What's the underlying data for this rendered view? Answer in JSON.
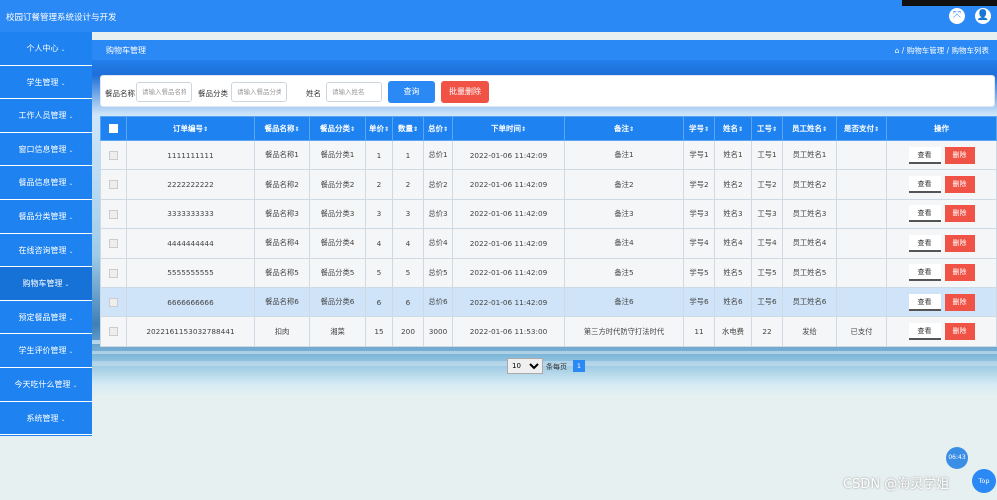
{
  "app": {
    "title": "校园订餐管理系统设计与开发"
  },
  "sidebar": {
    "items": [
      {
        "label": "个人中心"
      },
      {
        "label": "学生管理"
      },
      {
        "label": "工作人员管理"
      },
      {
        "label": "窗口信息管理"
      },
      {
        "label": "餐品信息管理"
      },
      {
        "label": "餐品分类管理"
      },
      {
        "label": "在线咨询管理"
      },
      {
        "label": "购物车管理"
      },
      {
        "label": "预定餐品管理"
      },
      {
        "label": "学生评价管理"
      },
      {
        "label": "今天吃什么管理"
      },
      {
        "label": "系统管理"
      }
    ]
  },
  "header": {
    "page_title": "购物车管理",
    "breadcrumb": "⌂ / 购物车管理 / 购物车列表"
  },
  "search": {
    "name_label": "餐品名称",
    "name_placeholder": "请输入餐品名称",
    "cat_label": "餐品分类",
    "cat_placeholder": "请输入餐品分类",
    "student_label": "姓名",
    "student_placeholder": "请输入姓名",
    "query_label": "查询",
    "batch_delete_label": "批量删除"
  },
  "table": {
    "headers": [
      "订单编号",
      "餐品名称",
      "餐品分类",
      "单价",
      "数量",
      "总价",
      "下单时间",
      "备注",
      "学号",
      "姓名",
      "工号",
      "员工姓名",
      "是否支付",
      "操作"
    ],
    "rows": [
      [
        "1111111111",
        "餐品名称1",
        "餐品分类1",
        "1",
        "1",
        "总价1",
        "2022-01-06 11:42:09",
        "备注1",
        "学号1",
        "姓名1",
        "工号1",
        "员工姓名1",
        ""
      ],
      [
        "2222222222",
        "餐品名称2",
        "餐品分类2",
        "2",
        "2",
        "总价2",
        "2022-01-06 11:42:09",
        "备注2",
        "学号2",
        "姓名2",
        "工号2",
        "员工姓名2",
        ""
      ],
      [
        "3333333333",
        "餐品名称3",
        "餐品分类3",
        "3",
        "3",
        "总价3",
        "2022-01-06 11:42:09",
        "备注3",
        "学号3",
        "姓名3",
        "工号3",
        "员工姓名3",
        ""
      ],
      [
        "4444444444",
        "餐品名称4",
        "餐品分类4",
        "4",
        "4",
        "总价4",
        "2022-01-06 11:42:09",
        "备注4",
        "学号4",
        "姓名4",
        "工号4",
        "员工姓名4",
        ""
      ],
      [
        "5555555555",
        "餐品名称5",
        "餐品分类5",
        "5",
        "5",
        "总价5",
        "2022-01-06 11:42:09",
        "备注5",
        "学号5",
        "姓名5",
        "工号5",
        "员工姓名5",
        ""
      ],
      [
        "6666666666",
        "餐品名称6",
        "餐品分类6",
        "6",
        "6",
        "总价6",
        "2022-01-06 11:42:09",
        "备注6",
        "学号6",
        "姓名6",
        "工号6",
        "员工姓名6",
        ""
      ],
      [
        "2022161153032788441",
        "扣肉",
        "湘菜",
        "15",
        "200",
        "3000",
        "2022-01-06 11:53:00",
        "第三方时代防守打法时代",
        "11",
        "水电费",
        "22",
        "发给",
        "已支付"
      ]
    ],
    "view_label": "查看",
    "delete_label": "删除"
  },
  "pagination": {
    "page_size": "10",
    "per_page_label": "条每页",
    "current_page": "1"
  },
  "overlay": {
    "clock": "06:43",
    "top_label": "Top",
    "watermark": "CSDN @海灵学姐"
  },
  "colors": {
    "primary": "#2b89f5",
    "danger": "#f15246"
  }
}
